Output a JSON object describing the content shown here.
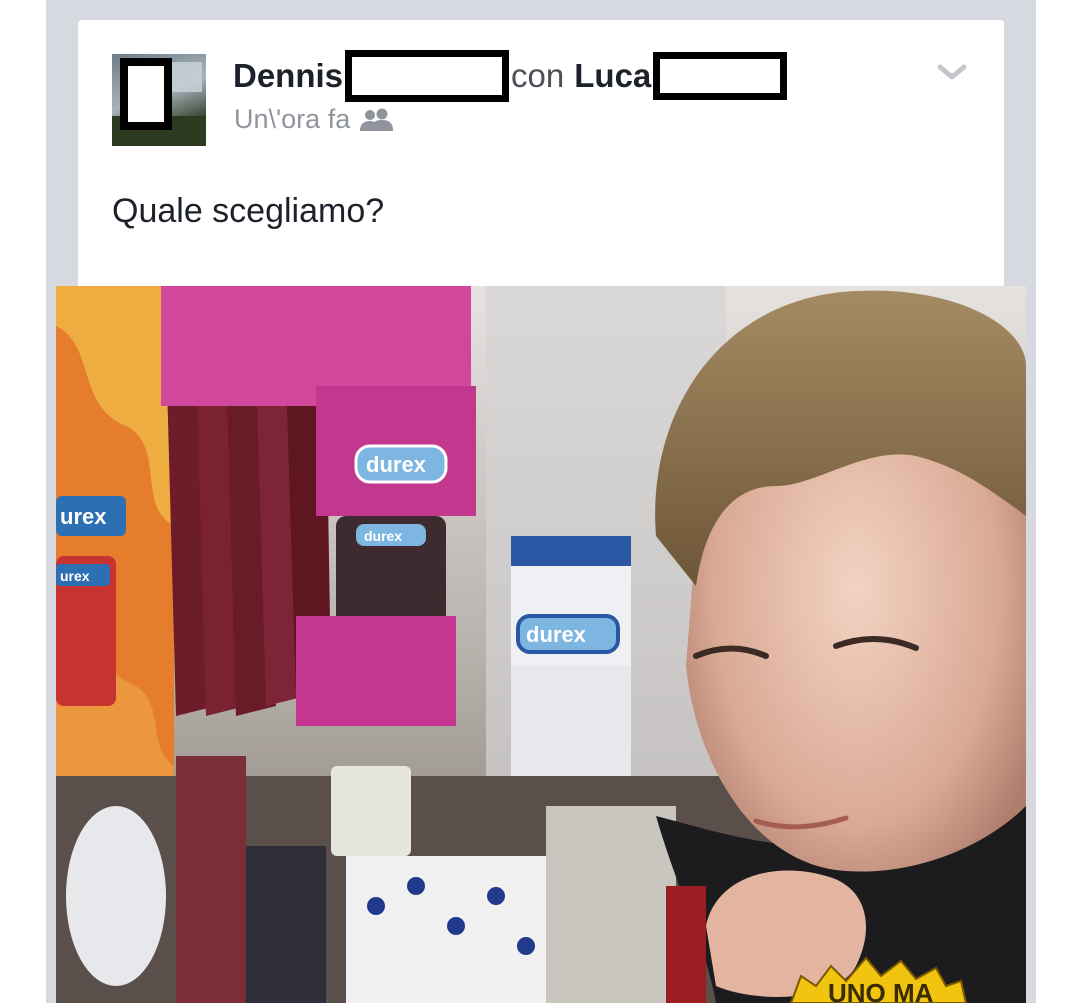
{
  "post": {
    "author": "Dennis",
    "with_word": "con",
    "tagged": "Luca",
    "timestamp": "Un\\'ora fa",
    "audience_icon": "friends-icon",
    "menu_icon": "chevron-down-icon",
    "text": "Quale scegliamo?"
  },
  "photo": {
    "brand_labels": [
      "urex",
      "urex",
      "durex",
      "durex",
      "durex"
    ],
    "badge_text": "UNO MA"
  },
  "colors": {
    "feed_background": "#d6d9e0",
    "card_background": "#ffffff",
    "name_text": "#1d2129",
    "secondary_text": "#90949c",
    "censor_bar": "#000000"
  }
}
